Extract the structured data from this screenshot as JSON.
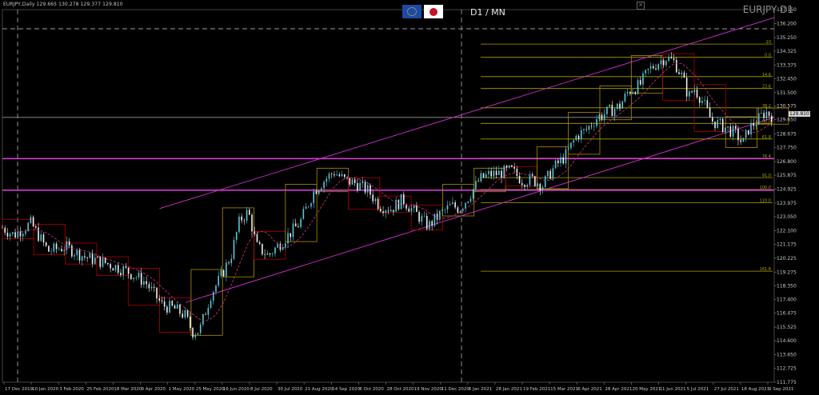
{
  "header": {
    "ohlc_text": "EURJPY,Daily  129.665 130.278 129.377 129.810",
    "timeframe_label": "D1 / MN",
    "symbol_watermark": "EURJPY D1",
    "close_label": "×",
    "flags": [
      "eu-flag-icon",
      "japan-flag-icon"
    ]
  },
  "price_tag": "129.810",
  "chart_data": {
    "type": "candlestick",
    "title": "",
    "ylim": [
      111.775,
      137.15
    ],
    "y_ticks": [
      137.15,
      136.2,
      135.25,
      134.325,
      133.375,
      132.45,
      131.5,
      130.575,
      129.65,
      128.675,
      127.75,
      126.8,
      125.875,
      124.925,
      123.975,
      123.05,
      122.1,
      121.175,
      120.225,
      119.275,
      118.35,
      117.4,
      116.475,
      115.525,
      114.6,
      113.65,
      112.725,
      111.775
    ],
    "x_ticks": [
      "17 Dec 2019",
      "10 Jan 2020",
      "3 Feb 2020",
      "25 Feb 2020",
      "18 Mar 2020",
      "9 Apr 2020",
      "1 May 2020",
      "25 May 2020",
      "16 Jun 2020",
      "8 Jul 2020",
      "30 Jul 2020",
      "21 Aug 2020",
      "14 Sep 2020",
      "6 Oct 2020",
      "28 Oct 2020",
      "19 Nov 2020",
      "11 Dec 2020",
      "6 Jan 2021",
      "28 Jan 2021",
      "19 Feb 2021",
      "15 Mar 2021",
      "6 Apr 2021",
      "28 Apr 2021",
      "20 May 2021",
      "11 Jun 2021",
      "5 Jul 2021",
      "27 Jul 2021",
      "18 Aug 2021",
      "9 Sep 2021"
    ],
    "fib_labels": [
      "0.0",
      "14.6",
      "23.6",
      "38.2",
      "50.0",
      "61.8",
      "76.4",
      "91.0",
      "100.0",
      "110.0",
      "161.8"
    ],
    "fib_top_label": "-10",
    "price_path": [
      [
        0,
        122.3
      ],
      [
        8,
        121.8
      ],
      [
        20,
        122.6
      ],
      [
        32,
        120.7
      ],
      [
        44,
        121.0
      ],
      [
        58,
        120.3
      ],
      [
        72,
        119.9
      ],
      [
        86,
        119.4
      ],
      [
        100,
        118.6
      ],
      [
        112,
        117.0
      ],
      [
        120,
        116.8
      ],
      [
        128,
        116.3
      ],
      [
        133,
        115.2
      ],
      [
        138,
        115.3
      ],
      [
        146,
        117.8
      ],
      [
        152,
        118.8
      ],
      [
        160,
        120.4
      ],
      [
        166,
        122.8
      ],
      [
        172,
        123.4
      ],
      [
        178,
        121.0
      ],
      [
        186,
        120.4
      ],
      [
        196,
        121.4
      ],
      [
        208,
        122.6
      ],
      [
        218,
        124.8
      ],
      [
        226,
        125.6
      ],
      [
        232,
        126.1
      ],
      [
        240,
        125.5
      ],
      [
        248,
        125.3
      ],
      [
        256,
        124.8
      ],
      [
        264,
        123.8
      ],
      [
        272,
        123.6
      ],
      [
        280,
        124.2
      ],
      [
        290,
        123.2
      ],
      [
        298,
        122.4
      ],
      [
        306,
        123.2
      ],
      [
        314,
        123.8
      ],
      [
        320,
        123.6
      ],
      [
        326,
        124.4
      ],
      [
        334,
        125.6
      ],
      [
        340,
        125.9
      ],
      [
        348,
        126.0
      ],
      [
        356,
        126.2
      ],
      [
        364,
        125.5
      ],
      [
        370,
        125.6
      ],
      [
        378,
        125.2
      ],
      [
        386,
        126.4
      ],
      [
        394,
        127.2
      ],
      [
        402,
        128.6
      ],
      [
        408,
        128.9
      ],
      [
        416,
        129.8
      ],
      [
        424,
        130.2
      ],
      [
        432,
        130.6
      ],
      [
        438,
        131.6
      ],
      [
        446,
        132.0
      ],
      [
        452,
        133.0
      ],
      [
        458,
        133.5
      ],
      [
        464,
        133.9
      ],
      [
        470,
        133.6
      ],
      [
        476,
        132.5
      ],
      [
        480,
        131.2
      ],
      [
        484,
        131.8
      ],
      [
        490,
        130.9
      ],
      [
        496,
        129.6
      ],
      [
        502,
        129.3
      ],
      [
        508,
        129.0
      ],
      [
        514,
        128.6
      ],
      [
        518,
        128.0
      ],
      [
        522,
        129.0
      ],
      [
        528,
        129.6
      ],
      [
        534,
        130.2
      ],
      [
        540,
        129.8
      ]
    ],
    "data_range_x": [
      0,
      540
    ],
    "series": [
      {
        "name": "EURJPY",
        "color": "#5ac8dc"
      }
    ],
    "fib_high": 133.9,
    "fib_low": 124.9,
    "horizontal_lines": [
      {
        "price": 127.0,
        "color": "#e040e0"
      },
      {
        "price": 124.85,
        "color": "#e040e0"
      },
      {
        "price": 129.81,
        "color": "#9a9a9a"
      }
    ],
    "channel_upper": {
      "x0": 110,
      "y0": 123.6,
      "x1": 540,
      "y1": 136.6
    },
    "channel_lower": {
      "x0": 128,
      "y0": 117.2,
      "x1": 540,
      "y1": 129.8
    },
    "grid": false
  },
  "colors": {
    "background": "#000000",
    "bull": "#5ac8dc",
    "bear": "#f0f0f0",
    "fib": "#b0a000",
    "channel": "#d030d0",
    "box_gold": "#b09000",
    "box_red": "#b00000"
  }
}
